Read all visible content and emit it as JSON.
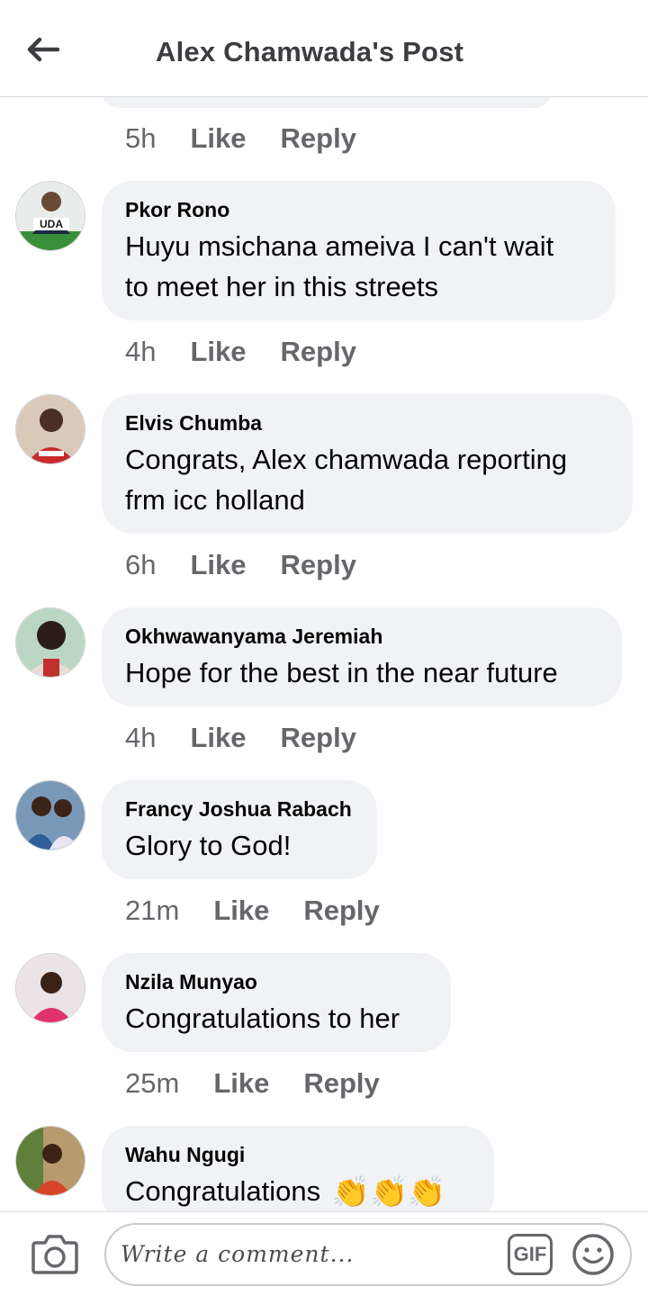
{
  "header": {
    "title": "Alex Chamwada's Post"
  },
  "top_meta": {
    "time": "5h",
    "like": "Like",
    "reply": "Reply"
  },
  "comments": [
    {
      "author": "Pkor Rono",
      "lines": [
        "Huyu msichana ameiva I can't wait",
        "to meet her in this streets"
      ],
      "time": "4h",
      "like": "Like",
      "reply": "Reply",
      "avatar_badge": "UDA"
    },
    {
      "author": "Elvis Chumba",
      "lines": [
        "Congrats, Alex chamwada reporting",
        "frm icc holland"
      ],
      "time": "6h",
      "like": "Like",
      "reply": "Reply"
    },
    {
      "author": "Okhwawanyama Jeremiah",
      "lines": [
        "Hope for the best in the near future"
      ],
      "time": "4h",
      "like": "Like",
      "reply": "Reply"
    },
    {
      "author": "Francy Joshua Rabach",
      "lines": [
        "Glory to God!"
      ],
      "time": "21m",
      "like": "Like",
      "reply": "Reply"
    },
    {
      "author": "Nzila Munyao",
      "lines": [
        "Congratulations to her"
      ],
      "time": "25m",
      "like": "Like",
      "reply": "Reply"
    },
    {
      "author": "Wahu Ngugi",
      "lines": [
        "Congratulations"
      ],
      "emoji": "👏👏👏"
    }
  ],
  "composer": {
    "placeholder": "Write a comment...",
    "gif_label": "GIF"
  },
  "icons": [
    "back-arrow-icon",
    "camera-icon",
    "gif-icon",
    "emoji-icon",
    "clapping-hands-icon"
  ]
}
